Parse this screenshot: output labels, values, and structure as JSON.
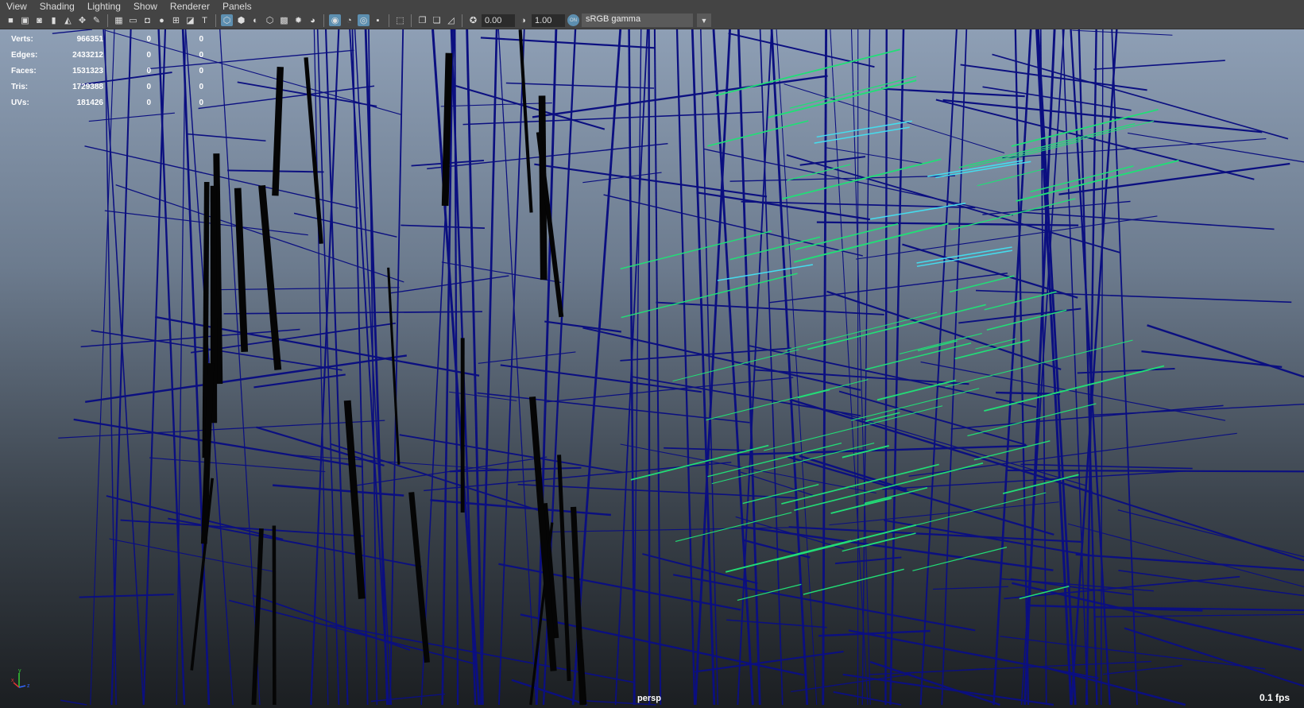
{
  "menu": [
    "View",
    "Shading",
    "Lighting",
    "Show",
    "Renderer",
    "Panels"
  ],
  "toolbar": {
    "exposure": "0.00",
    "gamma": "1.00",
    "colorspace": "sRGB gamma",
    "colorspace_toggle": "ON"
  },
  "stats": [
    {
      "label": "Verts:",
      "value": "966351",
      "a": "0",
      "b": "0"
    },
    {
      "label": "Edges:",
      "value": "2433212",
      "a": "0",
      "b": "0"
    },
    {
      "label": "Faces:",
      "value": "1531323",
      "a": "0",
      "b": "0"
    },
    {
      "label": "Tris:",
      "value": "1729388",
      "a": "0",
      "b": "0"
    },
    {
      "label": "UVs:",
      "value": "181426",
      "a": "0",
      "b": "0"
    }
  ],
  "viewport": {
    "camera": "persp",
    "fps": "0.1 fps",
    "axis": {
      "x": "x",
      "y": "y",
      "z": "z"
    }
  },
  "colors": {
    "wire": "#0b0f80",
    "selected": "#22dd77",
    "highlight": "#44ddee"
  }
}
